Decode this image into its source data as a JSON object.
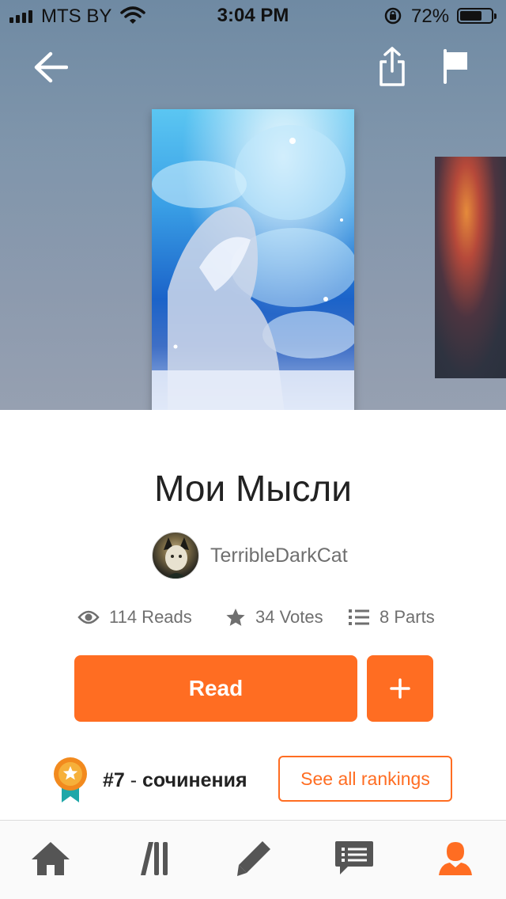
{
  "status_bar": {
    "carrier": "MTS BY",
    "time": "3:04 PM",
    "battery_percent": "72%",
    "battery_level": 0.72
  },
  "nav": {
    "back_icon": "arrow-left-icon",
    "share_icon": "share-icon",
    "report_icon": "flag-icon"
  },
  "story": {
    "title": "Мои Мысли",
    "author": "TerribleDarkCat",
    "reads": "114 Reads",
    "votes": "34 Votes",
    "parts": "8 Parts"
  },
  "actions": {
    "read_label": "Read",
    "add_label": "+"
  },
  "ranking": {
    "rank": "#7",
    "separator": " - ",
    "category": "сочинения",
    "see_all_label": "See all rankings"
  },
  "tabbar": {
    "items": [
      "home-icon",
      "library-icon",
      "write-icon",
      "messages-icon",
      "profile-icon"
    ],
    "active_index": 4
  },
  "colors": {
    "accent": "#ff6d22",
    "text_muted": "#6f6f6f",
    "tab_inactive": "#555555"
  }
}
